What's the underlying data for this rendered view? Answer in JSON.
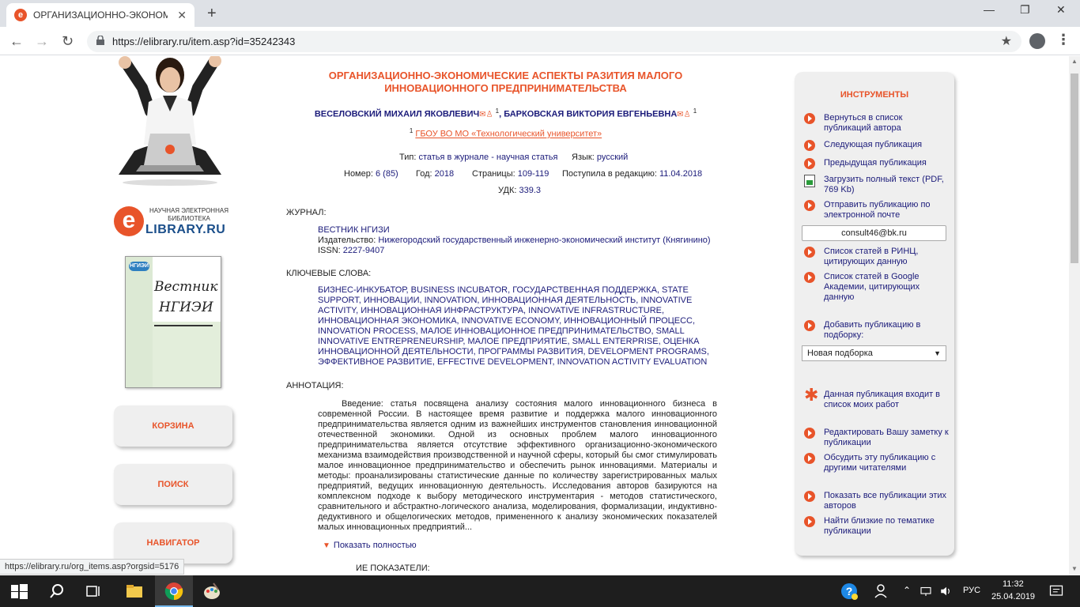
{
  "browser": {
    "tab_title": "ОРГАНИЗАЦИОННО-ЭКОНОМИ",
    "tab_favicon_letter": "e",
    "url": "https://elibrary.ru/item.asp?id=35242343",
    "new_tab_glyph": "+",
    "close_tab_glyph": "✕",
    "back_glyph": "←",
    "forward_glyph": "→",
    "reload_glyph": "↻",
    "bookmark_glyph": "★",
    "menu_glyph": "⋮",
    "minimize_glyph": "—",
    "maximize_glyph": "❐",
    "close_window_glyph": "✕"
  },
  "logo": {
    "letter": "e",
    "small_text": "НАУЧНАЯ ЭЛЕКТРОННАЯ БИБЛИОТЕКА",
    "big_text": "LIBRARY.RU"
  },
  "cover": {
    "badge": "НГИЭИ",
    "title_line1": "Вестник",
    "title_line2": "НГИЭИ"
  },
  "left_nav": {
    "cart": "КОРЗИНА",
    "search": "ПОИСК",
    "navigator": "НАВИГАТОР"
  },
  "article": {
    "title": "ОРГАНИЗАЦИОННО-ЭКОНОМИЧЕСКИЕ АСПЕКТЫ РАЗИТИЯ МАЛОГО ИННОВАЦИОННОГО ПРЕДПРИНИМАТЕЛЬСТВА",
    "author1": "ВЕСЕЛОВСКИЙ МИХАИЛ ЯКОВЛЕВИЧ",
    "author2": "БАРКОВСКАЯ ВИКТОРИЯ ЕВГЕНЬЕВНА",
    "author_sup": "1",
    "author_separator": ",",
    "mail_glyph": "✉",
    "person_glyph": "♙",
    "affil_sup": "1",
    "affiliation": "ГБОУ ВО МО «Технологический университет»",
    "type_label": "Тип:",
    "type_value": "статья в журнале - научная статья",
    "lang_label": "Язык:",
    "lang_value": "русский",
    "number_label": "Номер:",
    "number_value": "6 (85)",
    "year_label": "Год:",
    "year_value": "2018",
    "pages_label": "Страницы:",
    "pages_value": "109-119",
    "received_label": "Поступила в редакцию:",
    "received_value": "11.04.2018",
    "udk_label": "УДК:",
    "udk_value": "339.3"
  },
  "journal": {
    "section": "ЖУРНАЛ:",
    "name": "ВЕСТНИК НГИЗИ",
    "publisher_label": "Издательство:",
    "publisher_value": "Нижегородский государственный инженерно-экономический институт (Княгинино)",
    "issn_label": "ISSN:",
    "issn_value": "2227-9407"
  },
  "keywords": {
    "section": "КЛЮЧЕВЫЕ СЛОВА:",
    "text": "БИЗНЕС-ИНКУБАТОР, BUSINESS INCUBATOR, ГОСУДАРСТВЕННАЯ ПОДДЕРЖКА, STATE SUPPORT, ИННОВАЦИИ, INNOVATION, ИННОВАЦИОННАЯ ДЕЯТЕЛЬНОСТЬ, INNOVATIVE ACTIVITY, ИННОВАЦИОННАЯ ИНФРАСТРУКТУРА, INNOVATIVE INFRASTRUCTURE, ИННОВАЦИОННАЯ ЭКОНОМИКА, INNOVATIVE ECONOMY, ИННОВАЦИОННЫЙ ПРОЦЕСС, INNOVATION PROCESS, МАЛОЕ ИННОВАЦИОННОЕ ПРЕДПРИНИМАТЕЛЬСТВО, SMALL INNOVATIVE ENTREPRENEURSHIP, МАЛОЕ ПРЕДПРИЯТИЕ, SMALL ENTERPRISE, ОЦЕНКА ИННОВАЦИОННОЙ ДЕЯТЕЛЬНОСТИ, ПРОГРАММЫ РАЗВИТИЯ, DEVELOPMENT PROGRAMS, ЭФФЕКТИВНОЕ РАЗВИТИЕ, EFFECTIVE DEVELOPMENT, INNOVATION ACTIVITY EVALUATION"
  },
  "abstract": {
    "section": "АННОТАЦИЯ:",
    "text": "Введение: статья посвящена анализу состояния малого инновационного бизнеса в современной России. В настоящее время развитие и поддержка малого инновационного предпринимательства является одним из важнейших инструментов становления инновационной отечественной экономики. Одной из основных проблем малого инновационного предпринимательства является отсутствие эффективного организационно-экономического механизма взаимодействия производственной и научной сферы, который бы смог стимулировать малое инновационное предпринимательство и обеспечить рынок инновациями. Материалы и методы: проанализированы статистические данные по количеству зарегистрированных малых предприятий, ведущих инновационную деятельность. Исследования авторов базируются на комплексном подходе к выбору методического инструментария - методов статистического, сравнительного и абстрактно-логического анализа, моделирования, формализации, индуктивно-дедуктивного и общелогических методов, примененного к анализу экономических показателей малых инновационных предприятий...",
    "show_more": "Показать полностью",
    "show_more_glyph": "▼"
  },
  "partial_section": "ИЕ ПОКАЗАТЕЛИ:",
  "tools": {
    "title": "ИНСТРУМЕНТЫ",
    "back_to_list": "Вернуться в список публикаций автора",
    "next": "Следующая публикация",
    "prev": "Предыдущая публикация",
    "download": "Загрузить полный текст (PDF, 769 Kb)",
    "send_email": "Отправить публикацию по электронной почте",
    "email_value": "consult46@bk.ru",
    "rinc_list": "Список статей в РИНЦ, цитирующих данную",
    "google_list": "Список статей в Google Академии, цитирующих данную",
    "add_to": "Добавить публикацию в подборку:",
    "select_value": "Новая подборка",
    "select_arrow": "▼",
    "my_works": "Данная публикация входит в список моих работ",
    "asterisk_glyph": "✱",
    "edit_note": "Редактировать Вашу заметку к публикации",
    "discuss": "Обсудить эту публикацию с другими читателями",
    "show_all": "Показать все публикации этих авторов",
    "similar": "Найти близкие по тематике публикации"
  },
  "status_url": "https://elibrary.ru/org_items.asp?orgsid=5176",
  "taskbar": {
    "lang": "РУС",
    "time": "11:32",
    "date": "25.04.2019"
  }
}
